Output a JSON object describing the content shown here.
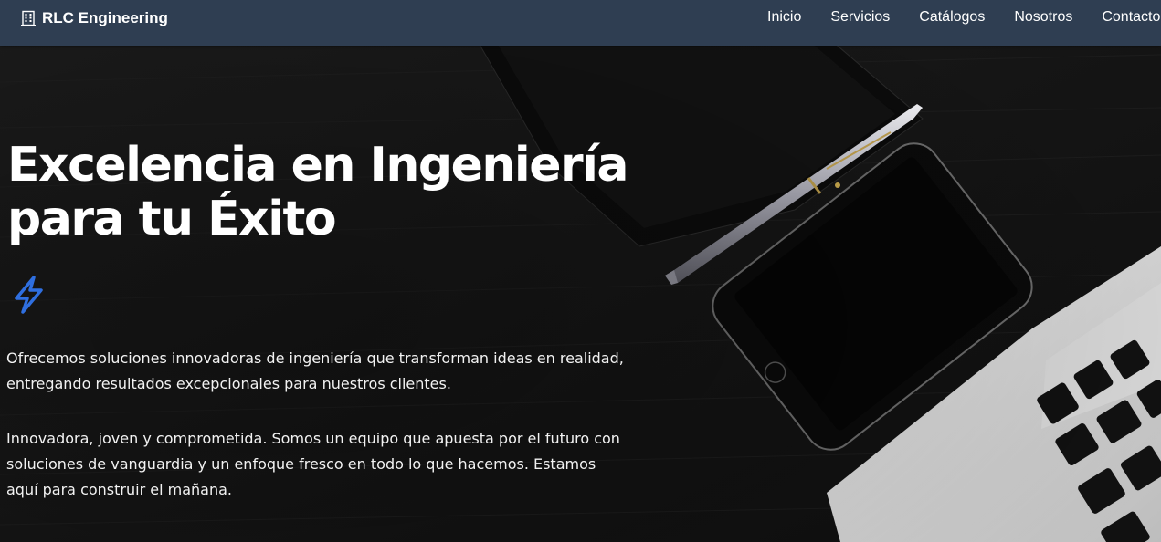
{
  "navbar": {
    "brand_icon": "building-icon",
    "brand_name": "RLC Engineering",
    "links": [
      {
        "label": "Inicio"
      },
      {
        "label": "Servicios"
      },
      {
        "label": "Catálogos"
      },
      {
        "label": "Nosotros"
      },
      {
        "label": "Contacto"
      }
    ]
  },
  "hero": {
    "title_line1": "Excelencia en Ingeniería",
    "title_line2": "para tu Éxito",
    "icon": "lightning-bolt-icon",
    "icon_color": "#2f6fe0",
    "paragraph1_line1": "Ofrecemos soluciones innovadoras de ingeniería que transforman ideas en realidad,",
    "paragraph1_line2": "entregando resultados excepcionales para nuestros clientes.",
    "paragraph2_line1": "Innovadora, joven y comprometida. Somos un equipo que apuesta por el futuro con",
    "paragraph2_line2": "soluciones de vanguardia y un enfoque fresco en todo lo que hacemos. Estamos",
    "paragraph2_line3": "aquí para construir el mañana."
  },
  "colors": {
    "navbar_bg": "#2f3e52",
    "text": "#ffffff",
    "accent": "#2f6fe0"
  }
}
